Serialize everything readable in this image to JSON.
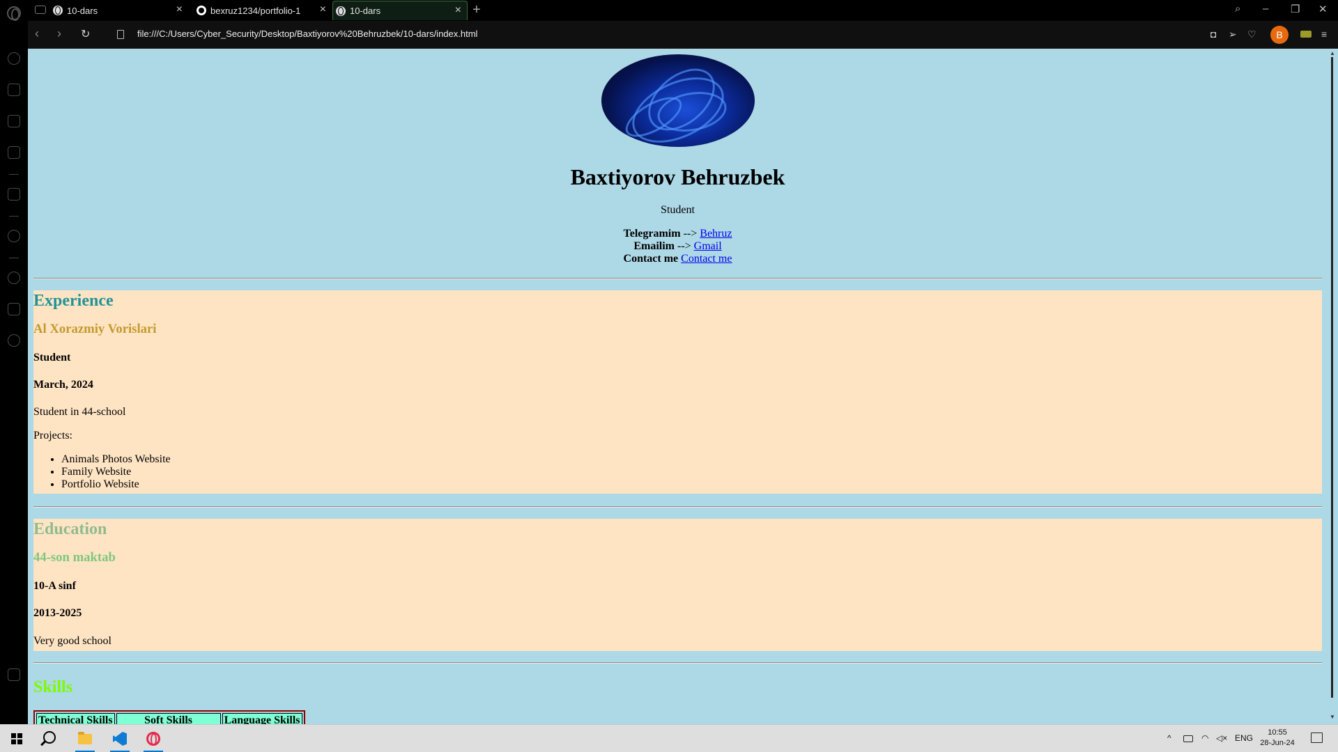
{
  "browser": {
    "tabs": [
      {
        "title": "10-dars",
        "icon": "globe-icon",
        "active": false
      },
      {
        "title": "bexruz1234/portfolio-1",
        "icon": "github-icon",
        "active": false
      },
      {
        "title": "10-dars",
        "icon": "globe-icon",
        "active": true
      }
    ],
    "new_tab": "+",
    "url": "file:///C:/Users/Cyber_Security/Desktop/Baxtiyorov%20Behruzbek/10-dars/index.html",
    "profile_initial": "B",
    "accent": "#3b6b3a"
  },
  "page": {
    "bg": "#add8e6",
    "section_bg": "#ffe4c4",
    "name": "Baxtiyorov Behruzbek",
    "role": "Student",
    "contacts": [
      {
        "label": "Telegramim",
        "sep": " --> ",
        "link": "Behruz"
      },
      {
        "label": "Emailim",
        "sep": " --> ",
        "link": "Gmail"
      },
      {
        "label": "Contact me",
        "sep": " ",
        "link": "Contact me"
      }
    ],
    "experience": {
      "title": "Experience",
      "title_color": "#20939a",
      "org": "Al Xorazmiy Vorislari",
      "org_color": "#c29a2c",
      "position": "Student",
      "date": "March, 2024",
      "desc": "Student in 44-school",
      "projects_label": "Projects:",
      "projects": [
        "Animals Photos Website",
        "Family Website",
        "Portfolio Website"
      ]
    },
    "education": {
      "title": "Education",
      "title_color": "#8fbc8f",
      "school": "44-son maktab",
      "school_color": "#7ec77e",
      "class": "10-A sinf",
      "years": "2013-2025",
      "desc": "Very good school"
    },
    "skills": {
      "title": "Skills",
      "title_color": "#7cfc00",
      "headers": [
        "Technical Skills",
        "Soft Skills",
        "Language Skills"
      ]
    }
  },
  "taskbar": {
    "lang": "ENG",
    "time": "10:55",
    "date": "28-Jun-24"
  }
}
